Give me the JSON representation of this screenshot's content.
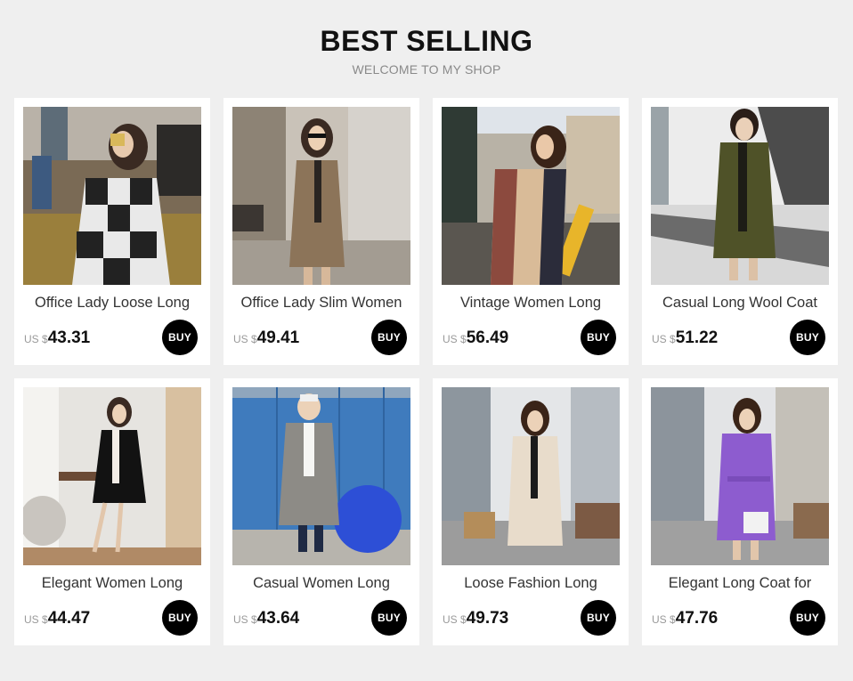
{
  "header": {
    "title": "BEST SELLING",
    "subtitle": "WELCOME TO MY SHOP"
  },
  "products": [
    {
      "name": "Office Lady Loose Long",
      "currency": "US $",
      "price": "43.31",
      "buy_label": "BUY"
    },
    {
      "name": "Office Lady Slim Women",
      "currency": "US $",
      "price": "49.41",
      "buy_label": "BUY"
    },
    {
      "name": "Vintage Women Long",
      "currency": "US $",
      "price": "56.49",
      "buy_label": "BUY"
    },
    {
      "name": "Casual Long Wool Coat",
      "currency": "US $",
      "price": "51.22",
      "buy_label": "BUY"
    },
    {
      "name": "Elegant Women Long",
      "currency": "US $",
      "price": "44.47",
      "buy_label": "BUY"
    },
    {
      "name": "Casual Women Long",
      "currency": "US $",
      "price": "43.64",
      "buy_label": "BUY"
    },
    {
      "name": "Loose Fashion Long",
      "currency": "US $",
      "price": "49.73",
      "buy_label": "BUY"
    },
    {
      "name": "Elegant Long Coat for",
      "currency": "US $",
      "price": "47.76",
      "buy_label": "BUY"
    }
  ]
}
